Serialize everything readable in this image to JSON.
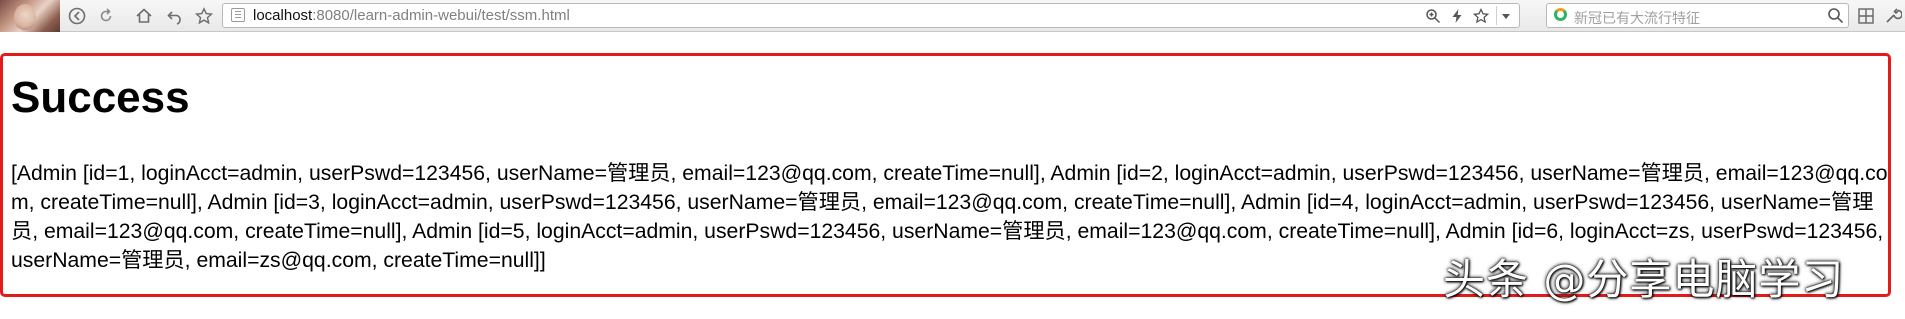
{
  "browser": {
    "url_host": "localhost",
    "url_path": ":8080/learn-admin-webui/test/ssm.html",
    "search_placeholder": "新冠已有大流行特征"
  },
  "page": {
    "heading": "Success",
    "body": "[Admin [id=1, loginAcct=admin, userPswd=123456, userName=管理员, email=123@qq.com, createTime=null], Admin [id=2, loginAcct=admin, userPswd=123456, userName=管理员, email=123@qq.com, createTime=null], Admin [id=3, loginAcct=admin, userPswd=123456, userName=管理员, email=123@qq.com, createTime=null], Admin [id=4, loginAcct=admin, userPswd=123456, userName=管理员, email=123@qq.com, createTime=null], Admin [id=5, loginAcct=admin, userPswd=123456, userName=管理员, email=123@qq.com, createTime=null], Admin [id=6, loginAcct=zs, userPswd=123456, userName=管理员, email=zs@qq.com, createTime=null]]"
  },
  "watermark": "头条 @分享电脑学习",
  "colors": {
    "highlight_border": "#e51b1b"
  },
  "icons": {
    "back": "back-arrow-icon",
    "forward": "forward-arrow-icon",
    "reload": "reload-icon",
    "home": "home-icon",
    "undo": "undo-icon",
    "bookmark": "star-icon",
    "zoom": "zoom-icon",
    "lightning": "lightning-icon",
    "search": "search-icon",
    "grid": "grid-icon",
    "tools": "wrench-icon"
  }
}
